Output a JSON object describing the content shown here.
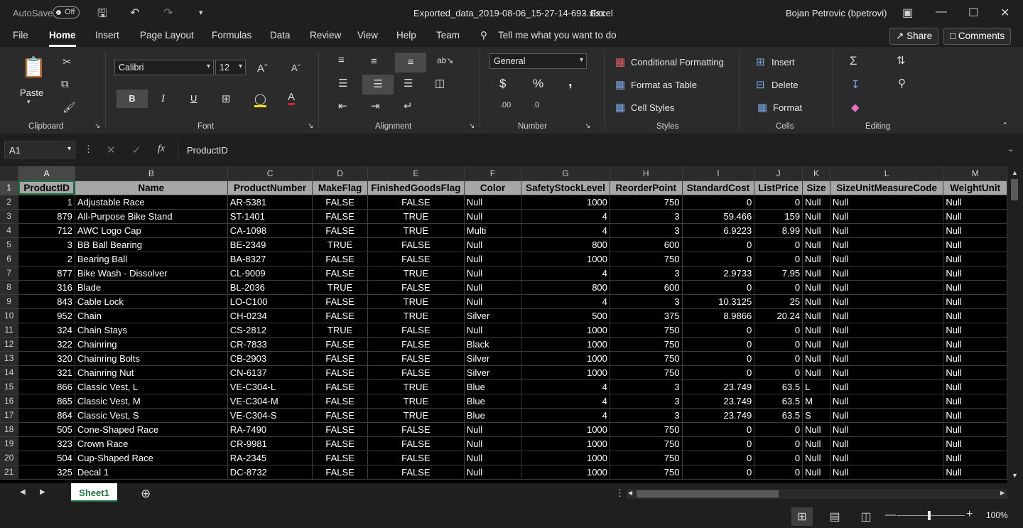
{
  "titlebar": {
    "autosave": "AutoSave",
    "toggle": "Off",
    "filename": "Exported_data_2019-08-06_15-27-14-693.xlsx",
    "sep": "-",
    "app": "Excel",
    "user": "Bojan Petrovic (bpetrovi)"
  },
  "tabs": [
    "File",
    "Home",
    "Insert",
    "Page Layout",
    "Formulas",
    "Data",
    "Review",
    "View",
    "Help",
    "Team"
  ],
  "tellme": "Tell me what you want to do",
  "share": "Share",
  "comments": "Comments",
  "ribbon": {
    "clipboard": {
      "paste": "Paste",
      "label": "Clipboard"
    },
    "font": {
      "name": "Calibri",
      "size": "12",
      "label": "Font",
      "bold": "B",
      "italic": "I",
      "underline": "U"
    },
    "alignment": {
      "label": "Alignment"
    },
    "number": {
      "format": "General",
      "label": "Number",
      "currency": "$",
      "percent": "%",
      "comma": ","
    },
    "styles": {
      "conditional": "Conditional Formatting",
      "table": "Format as Table",
      "cell": "Cell Styles",
      "label": "Styles"
    },
    "cells": {
      "insert": "Insert",
      "delete": "Delete",
      "format": "Format",
      "label": "Cells"
    },
    "editing": {
      "label": "Editing"
    }
  },
  "formulabar": {
    "namebox": "A1",
    "fx": "fx",
    "value": "ProductID"
  },
  "columns": [
    "A",
    "B",
    "C",
    "D",
    "E",
    "F",
    "G",
    "H",
    "I",
    "J",
    "K",
    "L",
    "M"
  ],
  "headers": [
    "ProductID",
    "Name",
    "ProductNumber",
    "MakeFlag",
    "FinishedGoodsFlag",
    "Color",
    "SafetyStockLevel",
    "ReorderPoint",
    "StandardCost",
    "ListPrice",
    "Size",
    "SizeUnitMeasureCode",
    "WeightUnit"
  ],
  "rows": [
    [
      "1",
      "Adjustable Race",
      "AR-5381",
      "FALSE",
      "FALSE",
      "Null",
      "1000",
      "750",
      "0",
      "0",
      "Null",
      "Null",
      "Null"
    ],
    [
      "879",
      "All-Purpose Bike Stand",
      "ST-1401",
      "FALSE",
      "TRUE",
      "Null",
      "4",
      "3",
      "59.466",
      "159",
      "Null",
      "Null",
      "Null"
    ],
    [
      "712",
      "AWC Logo Cap",
      "CA-1098",
      "FALSE",
      "TRUE",
      "Multi",
      "4",
      "3",
      "6.9223",
      "8.99",
      "Null",
      "Null",
      "Null"
    ],
    [
      "3",
      "BB Ball Bearing",
      "BE-2349",
      "TRUE",
      "FALSE",
      "Null",
      "800",
      "600",
      "0",
      "0",
      "Null",
      "Null",
      "Null"
    ],
    [
      "2",
      "Bearing Ball",
      "BA-8327",
      "FALSE",
      "FALSE",
      "Null",
      "1000",
      "750",
      "0",
      "0",
      "Null",
      "Null",
      "Null"
    ],
    [
      "877",
      "Bike Wash - Dissolver",
      "CL-9009",
      "FALSE",
      "TRUE",
      "Null",
      "4",
      "3",
      "2.9733",
      "7.95",
      "Null",
      "Null",
      "Null"
    ],
    [
      "316",
      "Blade",
      "BL-2036",
      "TRUE",
      "FALSE",
      "Null",
      "800",
      "600",
      "0",
      "0",
      "Null",
      "Null",
      "Null"
    ],
    [
      "843",
      "Cable Lock",
      "LO-C100",
      "FALSE",
      "TRUE",
      "Null",
      "4",
      "3",
      "10.3125",
      "25",
      "Null",
      "Null",
      "Null"
    ],
    [
      "952",
      "Chain",
      "CH-0234",
      "FALSE",
      "TRUE",
      "Silver",
      "500",
      "375",
      "8.9866",
      "20.24",
      "Null",
      "Null",
      "Null"
    ],
    [
      "324",
      "Chain Stays",
      "CS-2812",
      "TRUE",
      "FALSE",
      "Null",
      "1000",
      "750",
      "0",
      "0",
      "Null",
      "Null",
      "Null"
    ],
    [
      "322",
      "Chainring",
      "CR-7833",
      "FALSE",
      "FALSE",
      "Black",
      "1000",
      "750",
      "0",
      "0",
      "Null",
      "Null",
      "Null"
    ],
    [
      "320",
      "Chainring Bolts",
      "CB-2903",
      "FALSE",
      "FALSE",
      "Silver",
      "1000",
      "750",
      "0",
      "0",
      "Null",
      "Null",
      "Null"
    ],
    [
      "321",
      "Chainring Nut",
      "CN-6137",
      "FALSE",
      "FALSE",
      "Silver",
      "1000",
      "750",
      "0",
      "0",
      "Null",
      "Null",
      "Null"
    ],
    [
      "866",
      "Classic Vest, L",
      "VE-C304-L",
      "FALSE",
      "TRUE",
      "Blue",
      "4",
      "3",
      "23.749",
      "63.5",
      "L",
      "Null",
      "Null"
    ],
    [
      "865",
      "Classic Vest, M",
      "VE-C304-M",
      "FALSE",
      "TRUE",
      "Blue",
      "4",
      "3",
      "23.749",
      "63.5",
      "M",
      "Null",
      "Null"
    ],
    [
      "864",
      "Classic Vest, S",
      "VE-C304-S",
      "FALSE",
      "TRUE",
      "Blue",
      "4",
      "3",
      "23.749",
      "63.5",
      "S",
      "Null",
      "Null"
    ],
    [
      "505",
      "Cone-Shaped Race",
      "RA-7490",
      "FALSE",
      "FALSE",
      "Null",
      "1000",
      "750",
      "0",
      "0",
      "Null",
      "Null",
      "Null"
    ],
    [
      "323",
      "Crown Race",
      "CR-9981",
      "FALSE",
      "FALSE",
      "Null",
      "1000",
      "750",
      "0",
      "0",
      "Null",
      "Null",
      "Null"
    ],
    [
      "504",
      "Cup-Shaped Race",
      "RA-2345",
      "FALSE",
      "FALSE",
      "Null",
      "1000",
      "750",
      "0",
      "0",
      "Null",
      "Null",
      "Null"
    ],
    [
      "325",
      "Decal 1",
      "DC-8732",
      "FALSE",
      "FALSE",
      "Null",
      "1000",
      "750",
      "0",
      "0",
      "Null",
      "Null",
      "Null"
    ]
  ],
  "sheet": "Sheet1",
  "zoom": "100%"
}
